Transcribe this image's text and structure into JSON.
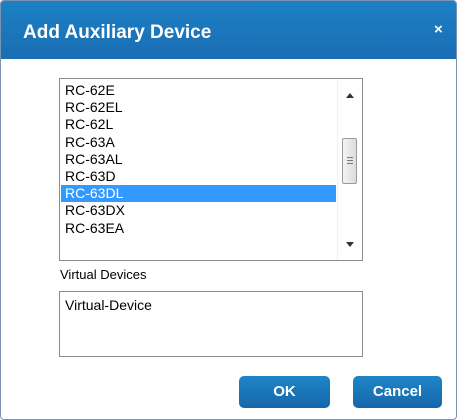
{
  "dialog": {
    "title": "Add Auxiliary Device",
    "close_glyph": "×",
    "device_list": {
      "items": [
        "RC-62E",
        "RC-62EL",
        "RC-62L",
        "RC-63A",
        "RC-63AL",
        "RC-63D",
        "RC-63DL",
        "RC-63DX",
        "RC-63EA"
      ],
      "selected": "RC-63DL"
    },
    "virtual_devices": {
      "label": "Virtual Devices",
      "items": [
        "Virtual-Device"
      ]
    },
    "buttons": {
      "ok_label": "OK",
      "cancel_label": "Cancel"
    },
    "colors": {
      "titlebar": "#1a6db3",
      "selection": "#3399ff",
      "button": "#1a72b8"
    }
  }
}
